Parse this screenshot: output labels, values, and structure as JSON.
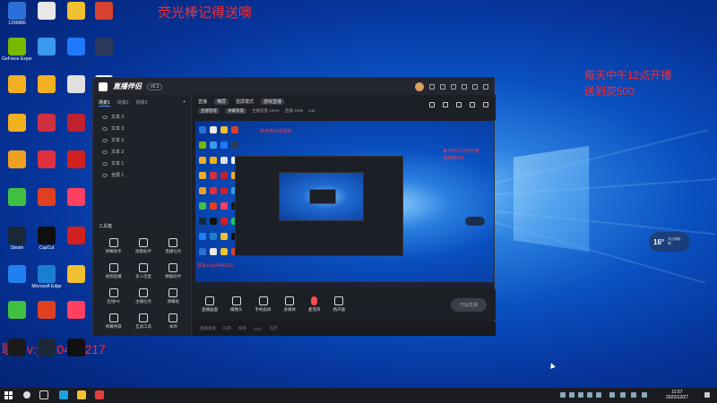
{
  "overlay": {
    "top_text": "荧光棒记得送噢",
    "right_line1": "每天中午12点开播",
    "right_line2": "送到荧500",
    "bottom_text": "联系v:ya20446217"
  },
  "desktop_icons": [
    {
      "label": "1296886",
      "color": "#2a6fd6"
    },
    {
      "label": "",
      "color": "#e8e8e8"
    },
    {
      "label": "",
      "color": "#f0c030"
    },
    {
      "label": "",
      "color": "#d84030"
    },
    {
      "label": "GeForce Experience",
      "color": "#76b900"
    },
    {
      "label": "",
      "color": "#3a9af0"
    },
    {
      "label": "",
      "color": "#1f78ff"
    },
    {
      "label": "",
      "color": "#2b3a5a"
    },
    {
      "label": "",
      "color": "#f0b020"
    },
    {
      "label": "",
      "color": "#f0b020"
    },
    {
      "label": "",
      "color": "#e0e0e0"
    },
    {
      "label": "",
      "color": "#f0f0f0"
    },
    {
      "label": "",
      "color": "#f0b020"
    },
    {
      "label": "",
      "color": "#d03040"
    },
    {
      "label": "",
      "color": "#c02030"
    },
    {
      "label": "",
      "color": "#f0b020"
    },
    {
      "label": "",
      "color": "#f0a020"
    },
    {
      "label": "",
      "color": "#e03040"
    },
    {
      "label": "",
      "color": "#d02020"
    },
    {
      "label": "",
      "color": "#2aa0e0"
    },
    {
      "label": "",
      "color": "#40c040"
    },
    {
      "label": "",
      "color": "#e04020"
    },
    {
      "label": "",
      "color": "#ff4060"
    },
    {
      "label": "",
      "color": "#1a1a1a"
    },
    {
      "label": "Steam",
      "color": "#1b2838"
    },
    {
      "label": "CapCut",
      "color": "#101010"
    },
    {
      "label": "",
      "color": "#d02020"
    },
    {
      "label": "",
      "color": "#20c060"
    },
    {
      "label": "",
      "color": "#2080f0"
    },
    {
      "label": "Microsoft Edge",
      "color": "#1a7fd0"
    },
    {
      "label": "",
      "color": "#f0c030"
    },
    {
      "label": "",
      "color": "#101010"
    }
  ],
  "app": {
    "title": "直播伴侣",
    "version": "v6.3",
    "left_tabs": [
      "场景1",
      "场景2",
      "场景3"
    ],
    "sources": [
      "文本 3",
      "文本 3",
      "文本 2",
      "文本 2",
      "文本 1",
      "全屏 1"
    ],
    "tools_header": "工具箱",
    "tools": [
      "弹幕助手",
      "观看助手",
      "直播任务",
      "视频直播",
      "多人连麦",
      "数据助手",
      "连线PK",
      "主播任务",
      "弹幕板",
      "弹幕神器",
      "互动工具",
      "本场"
    ],
    "stage_tabs": [
      "直播",
      "横屏",
      "竖屏模式",
      "游戏直播"
    ],
    "stage_info": [
      "直播管理",
      "弹幕管理",
      "主播音量 100%",
      "直播 3299",
      "142"
    ],
    "bottom_tools": [
      "直播画面",
      "摄像头",
      "手机投屏",
      "多媒体",
      "麦克风",
      "扬声器"
    ],
    "start_button": "开始直播",
    "status_items": [
      "直播质量",
      "码率",
      "帧率",
      "CPU",
      "内存"
    ]
  },
  "preview_overlays": {
    "red1": "荧光棒记得送噢",
    "red2": "每天中午12点开播",
    "red3": "送到荧500",
    "bottom": "联系v:ya20446217"
  },
  "widget": {
    "temp": "16°",
    "line1": "多云转阴",
    "line2": "晴"
  },
  "taskbar": {
    "time": "11:57",
    "date": "2022/12/27"
  }
}
